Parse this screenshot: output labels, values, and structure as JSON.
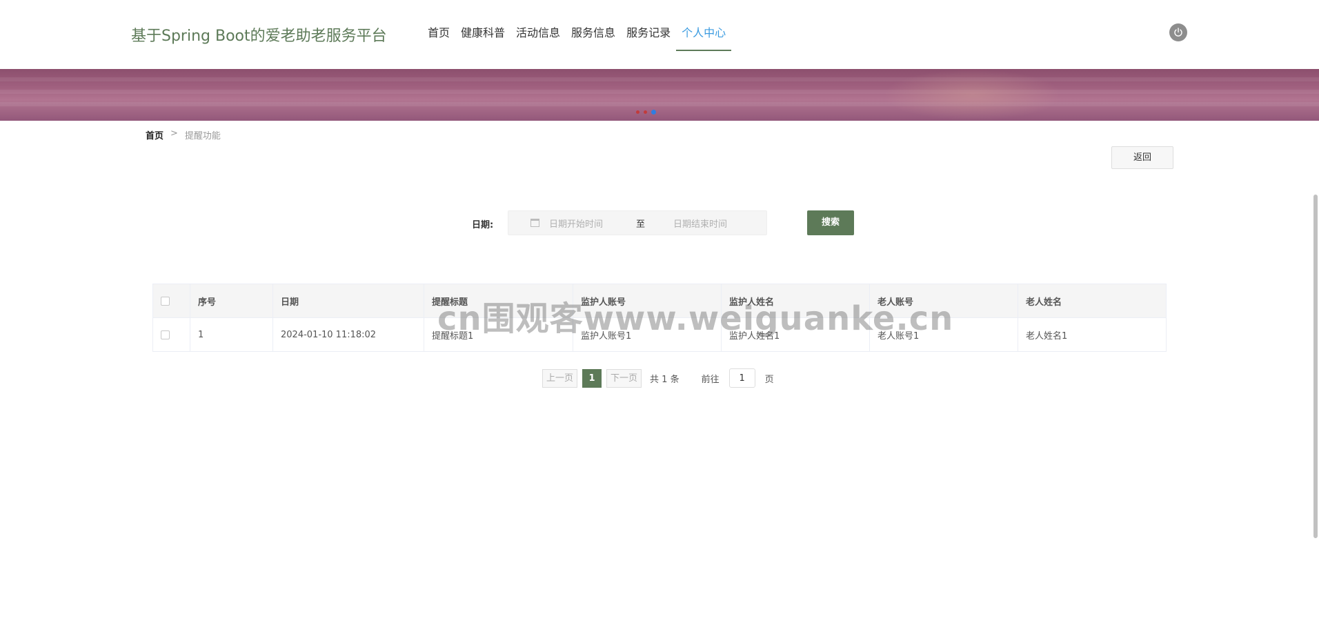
{
  "header": {
    "site_title": "基于Spring Boot的爱老助老服务平台",
    "nav": [
      {
        "label": "首页"
      },
      {
        "label": "健康科普"
      },
      {
        "label": "活动信息"
      },
      {
        "label": "服务信息"
      },
      {
        "label": "服务记录"
      },
      {
        "label": "个人中心",
        "active": true
      }
    ]
  },
  "breadcrumb": {
    "home": "首页",
    "separator": ">",
    "current": "提醒功能"
  },
  "back_button": "返回",
  "search": {
    "label": "日期:",
    "start_placeholder": "日期开始时间",
    "range_separator": "至",
    "end_placeholder": "日期结束时间",
    "button": "搜索"
  },
  "table": {
    "headers": [
      "序号",
      "日期",
      "提醒标题",
      "监护人账号",
      "监护人姓名",
      "老人账号",
      "老人姓名"
    ],
    "rows": [
      [
        "1",
        "2024-01-10 11:18:02",
        "提醒标题1",
        "监护人账号1",
        "监护人姓名1",
        "老人账号1",
        "老人姓名1"
      ]
    ]
  },
  "pagination": {
    "prev": "上一页",
    "current_page": "1",
    "next": "下一页",
    "total": "共 1 条",
    "goto_label": "前往",
    "goto_value": "1",
    "page_suffix": "页"
  },
  "watermark": "cn围观客www.weiguanke.cn",
  "colors": {
    "accent": "#5d7a58",
    "active_nav": "#3b9be0"
  }
}
